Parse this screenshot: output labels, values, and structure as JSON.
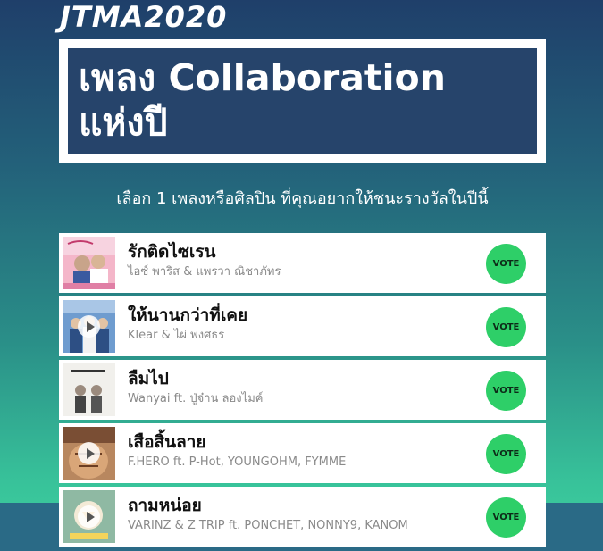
{
  "header": {
    "logo_text": "JTMA2020",
    "category_title_line1": "เพลง Collaboration",
    "category_title_line2": "แห่งปี",
    "instruction": "เลือก 1 เพลงหรือศิลปิน ที่คุณอยากให้ชนะรางวัลในปีนี้"
  },
  "colors": {
    "vote_button": "#2ecf68",
    "title_box": "#26446b",
    "background_top": "#1f3f6a",
    "background_bottom": "#3fcf9f"
  },
  "candidates": [
    {
      "title": "รักติดไซเรน",
      "artist": "ไอซ์ พาริส & แพรวา ณิชาภัทร",
      "vote_label": "VOTE",
      "cover_icon": "album-cover-image"
    },
    {
      "title": "ให้นานกว่าที่เคย",
      "artist": "Klear & ไผ่ พงศธร",
      "vote_label": "VOTE",
      "cover_icon": "album-cover-image"
    },
    {
      "title": "ลืมไป",
      "artist": "Wanyai ft. ปู่จ๋าน ลองไมค์",
      "vote_label": "VOTE",
      "cover_icon": "album-cover-image"
    },
    {
      "title": "เสือสิ้นลาย",
      "artist": "F.HERO ft. P-Hot, YOUNGOHM, FYMME",
      "vote_label": "VOTE",
      "cover_icon": "album-cover-image"
    },
    {
      "title": "ถามหน่อย",
      "artist": "VARINZ & Z TRIP ft. PONCHET, NONNY9, KANOM",
      "vote_label": "VOTE",
      "cover_icon": "album-cover-image"
    }
  ]
}
